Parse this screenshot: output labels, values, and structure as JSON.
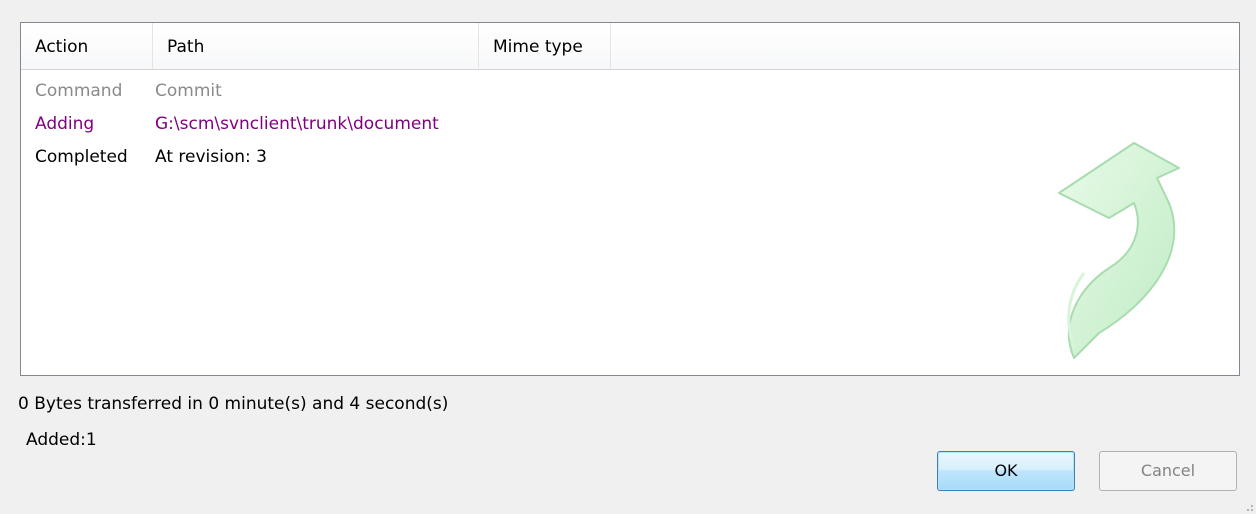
{
  "columns": {
    "action": "Action",
    "path": "Path",
    "mime": "Mime type"
  },
  "rows": [
    {
      "action": "Command",
      "path": "Commit",
      "kind": "command"
    },
    {
      "action": "Adding",
      "path": "G:\\scm\\svnclient\\trunk\\document",
      "kind": "added"
    },
    {
      "action": "Completed",
      "path": "At revision: 3",
      "kind": "completed"
    }
  ],
  "status": {
    "transfer": "0 Bytes transferred in 0 minute(s) and 4 second(s)",
    "added": "Added:1"
  },
  "buttons": {
    "ok": "OK",
    "cancel": "Cancel"
  },
  "watermark_icon": "commit-arrow-icon",
  "colors": {
    "command": "#8a8a8a",
    "added": "#800080",
    "completed": "#000000",
    "watermark": "#c8f0c8"
  }
}
